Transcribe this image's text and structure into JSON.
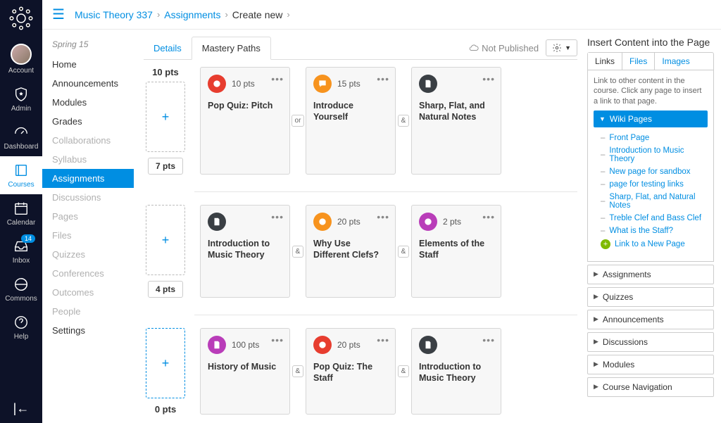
{
  "gnav": {
    "items": [
      {
        "label": "Account"
      },
      {
        "label": "Admin"
      },
      {
        "label": "Dashboard"
      },
      {
        "label": "Courses"
      },
      {
        "label": "Calendar"
      },
      {
        "label": "Inbox",
        "badge": "14"
      },
      {
        "label": "Commons"
      },
      {
        "label": "Help"
      }
    ]
  },
  "breadcrumb": {
    "course": "Music Theory 337",
    "section": "Assignments",
    "page": "Create new"
  },
  "cnav": {
    "term": "Spring 15",
    "items": [
      {
        "label": "Home"
      },
      {
        "label": "Announcements"
      },
      {
        "label": "Modules"
      },
      {
        "label": "Grades"
      },
      {
        "label": "Collaborations",
        "disabled": true
      },
      {
        "label": "Syllabus",
        "disabled": true
      },
      {
        "label": "Assignments",
        "active": true
      },
      {
        "label": "Discussions",
        "disabled": true
      },
      {
        "label": "Pages",
        "disabled": true
      },
      {
        "label": "Files",
        "disabled": true
      },
      {
        "label": "Quizzes",
        "disabled": true
      },
      {
        "label": "Conferences",
        "disabled": true
      },
      {
        "label": "Outcomes",
        "disabled": true
      },
      {
        "label": "People",
        "disabled": true
      },
      {
        "label": "Settings"
      }
    ]
  },
  "tabs": {
    "details": "Details",
    "mastery": "Mastery Paths",
    "status": "Not Published"
  },
  "ranges": [
    {
      "top": "10 pts",
      "bottom": "7 pts",
      "bottom_boxed": true,
      "joiners": [
        "or",
        "&"
      ],
      "cards": [
        {
          "icon": "target",
          "color": "red",
          "pts": "10 pts",
          "title": "Pop Quiz: Pitch"
        },
        {
          "icon": "chat",
          "color": "orange",
          "pts": "15 pts",
          "title": "Introduce Yourself"
        },
        {
          "icon": "doc",
          "color": "dark",
          "pts": "",
          "title": "Sharp, Flat, and Natural Notes"
        }
      ]
    },
    {
      "top": "",
      "bottom": "4 pts",
      "bottom_boxed": true,
      "joiners": [
        "&",
        "&"
      ],
      "cards": [
        {
          "icon": "doc",
          "color": "dark",
          "pts": "",
          "title": "Introduction to Music Theory"
        },
        {
          "icon": "target",
          "color": "orange",
          "pts": "20 pts",
          "title": "Why Use Different Clefs?"
        },
        {
          "icon": "target",
          "color": "purple",
          "pts": "2 pts",
          "title": "Elements of the Staff"
        }
      ]
    },
    {
      "top": "",
      "bottom": "0 pts",
      "bottom_boxed": false,
      "selected": true,
      "joiners": [
        "&",
        "&"
      ],
      "cards": [
        {
          "icon": "doc",
          "color": "purple",
          "pts": "100 pts",
          "title": "History of Music"
        },
        {
          "icon": "target",
          "color": "red",
          "pts": "20 pts",
          "title": "Pop Quiz: The Staff"
        },
        {
          "icon": "doc",
          "color": "dark",
          "pts": "",
          "title": "Introduction to Music Theory"
        }
      ]
    }
  ],
  "rpanel": {
    "title": "Insert Content into the Page",
    "tabs": [
      "Links",
      "Files",
      "Images"
    ],
    "hint": "Link to other content in the course. Click any page to insert a link to that page.",
    "wiki_header": "Wiki Pages",
    "wiki_links": [
      "Front Page",
      "Introduction to Music Theory",
      "New page for sandbox",
      "page for testing links",
      "Sharp, Flat, and Natural Notes",
      "Treble Clef and Bass Clef",
      "What is the Staff?"
    ],
    "new_page": "Link to a New Page",
    "sections": [
      "Assignments",
      "Quizzes",
      "Announcements",
      "Discussions",
      "Modules",
      "Course Navigation"
    ]
  }
}
